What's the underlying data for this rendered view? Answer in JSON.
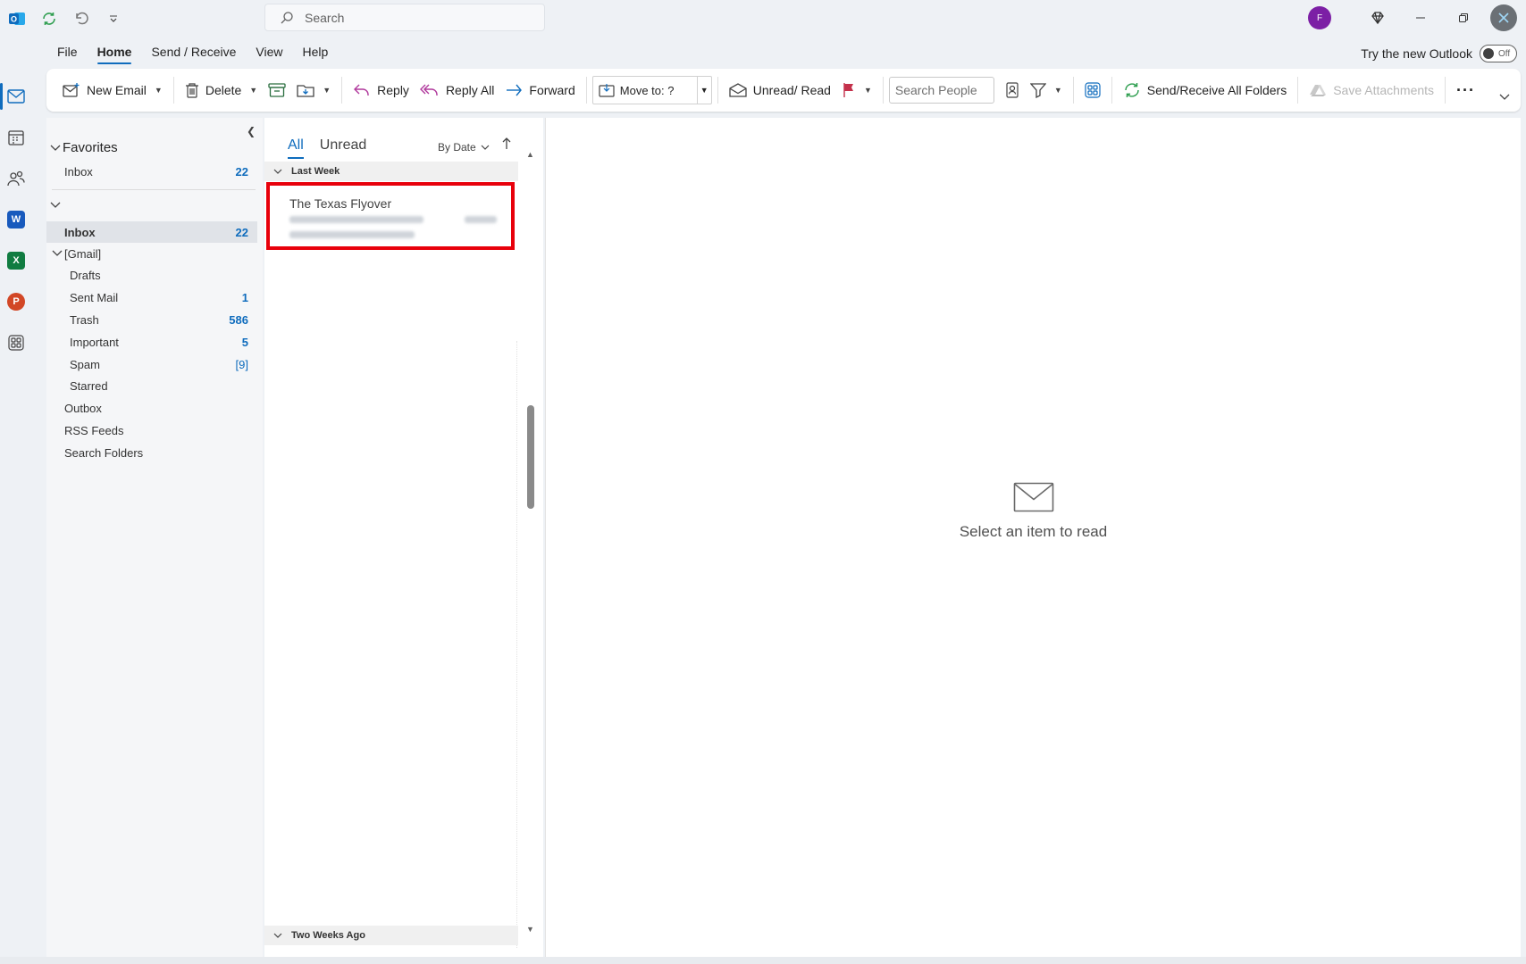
{
  "titlebar": {
    "search_placeholder": "Search",
    "avatar_initial": "F"
  },
  "menu": {
    "tabs": [
      "File",
      "Home",
      "Send / Receive",
      "View",
      "Help"
    ],
    "active_tab": "Home",
    "try_new_label": "Try the new Outlook",
    "toggle_label": "Off"
  },
  "ribbon": {
    "new_email": "New Email",
    "delete": "Delete",
    "reply": "Reply",
    "reply_all": "Reply All",
    "forward": "Forward",
    "move_to": "Move to: ?",
    "unread_read": "Unread/ Read",
    "search_people_placeholder": "Search People",
    "send_receive_all": "Send/Receive All Folders",
    "save_attachments": "Save Attachments",
    "more": "···"
  },
  "folders": {
    "favorites_label": "Favorites",
    "favorites_inbox": {
      "label": "Inbox",
      "count": "22"
    },
    "inbox": {
      "label": "Inbox",
      "count": "22"
    },
    "gmail_label": "[Gmail]",
    "gmail_items": [
      {
        "label": "Drafts",
        "count": ""
      },
      {
        "label": "Sent Mail",
        "count": "1"
      },
      {
        "label": "Trash",
        "count": "586"
      },
      {
        "label": "Important",
        "count": "5"
      },
      {
        "label": "Spam",
        "count": "[9]"
      },
      {
        "label": "Starred",
        "count": ""
      }
    ],
    "other_items": [
      "Outbox",
      "RSS Feeds",
      "Search Folders"
    ]
  },
  "message_list": {
    "tab_all": "All",
    "tab_unread": "Unread",
    "sort_label": "By Date",
    "group_last_week": "Last Week",
    "group_two_weeks": "Two Weeks Ago",
    "messages": [
      {
        "from": "The Texas Flyover",
        "subject": "Blue Collar Job Demand at 4...",
        "preview": "Blue collar workers in the U.S.",
        "date": "Sat 5/4"
      }
    ]
  },
  "reading_pane": {
    "empty_text": "Select an item to read"
  },
  "colors": {
    "accent": "#0f6cbd",
    "highlight_box": "#e8000b",
    "avatar": "#7c1fa5"
  }
}
